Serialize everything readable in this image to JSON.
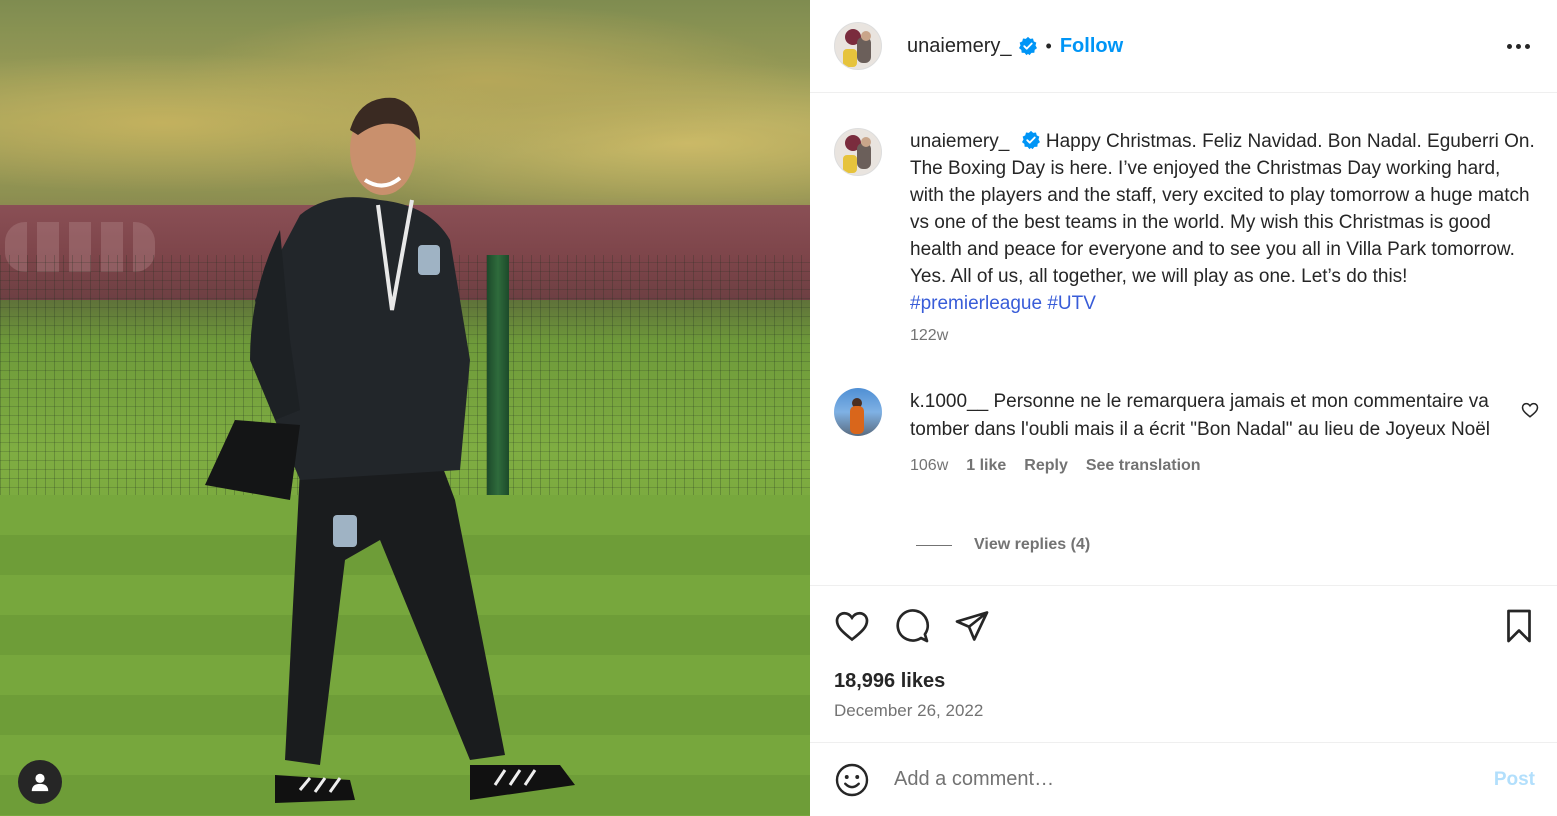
{
  "post": {
    "image_alt": "Man in dark tracksuit walking on training pitch",
    "author": "unaiemery_",
    "verified": true,
    "follow_label": "Follow",
    "separator": "•"
  },
  "caption": {
    "username": "unaiemery_",
    "text": "Happy Christmas. Feliz Navidad. Bon Nadal. Eguberri On. The Boxing Day is here. I’ve enjoyed the Christmas Day working hard, with the players and the staff, very excited to play tomorrow a huge match vs one of the best teams in the world. My wish this Christmas is good health and peace for everyone and to see you all in Villa Park tomorrow. Yes. All of us, all together, we will play as one. Let’s do this! ",
    "hashtags": [
      "#premierleague",
      "#UTV"
    ],
    "time": "122w"
  },
  "comment": {
    "username": "k.1000__",
    "text": "Personne ne le remarquera jamais et mon commentaire va tomber dans l'oubli mais il a écrit \"Bon Nadal\" au lieu de Joyeux Noël",
    "time": "106w",
    "likes": "1 like",
    "reply_label": "Reply",
    "translation_label": "See translation",
    "view_replies": "View replies (4)"
  },
  "stats": {
    "likes": "18,996 likes",
    "date": "December 26, 2022"
  },
  "composer": {
    "placeholder": "Add a comment…",
    "post_label": "Post"
  },
  "colors": {
    "accent": "#0095f6",
    "hashtag": "#385cd8",
    "muted": "#737373",
    "text": "#262626",
    "post_disabled": "#b2dffc"
  },
  "icons": {
    "header": [
      "verified-badge-icon",
      "more-options-icon"
    ],
    "actions": [
      "heart-icon",
      "comment-icon",
      "share-icon",
      "bookmark-icon"
    ],
    "composer": [
      "emoji-icon"
    ],
    "photo": [
      "user-tag-icon"
    ]
  }
}
